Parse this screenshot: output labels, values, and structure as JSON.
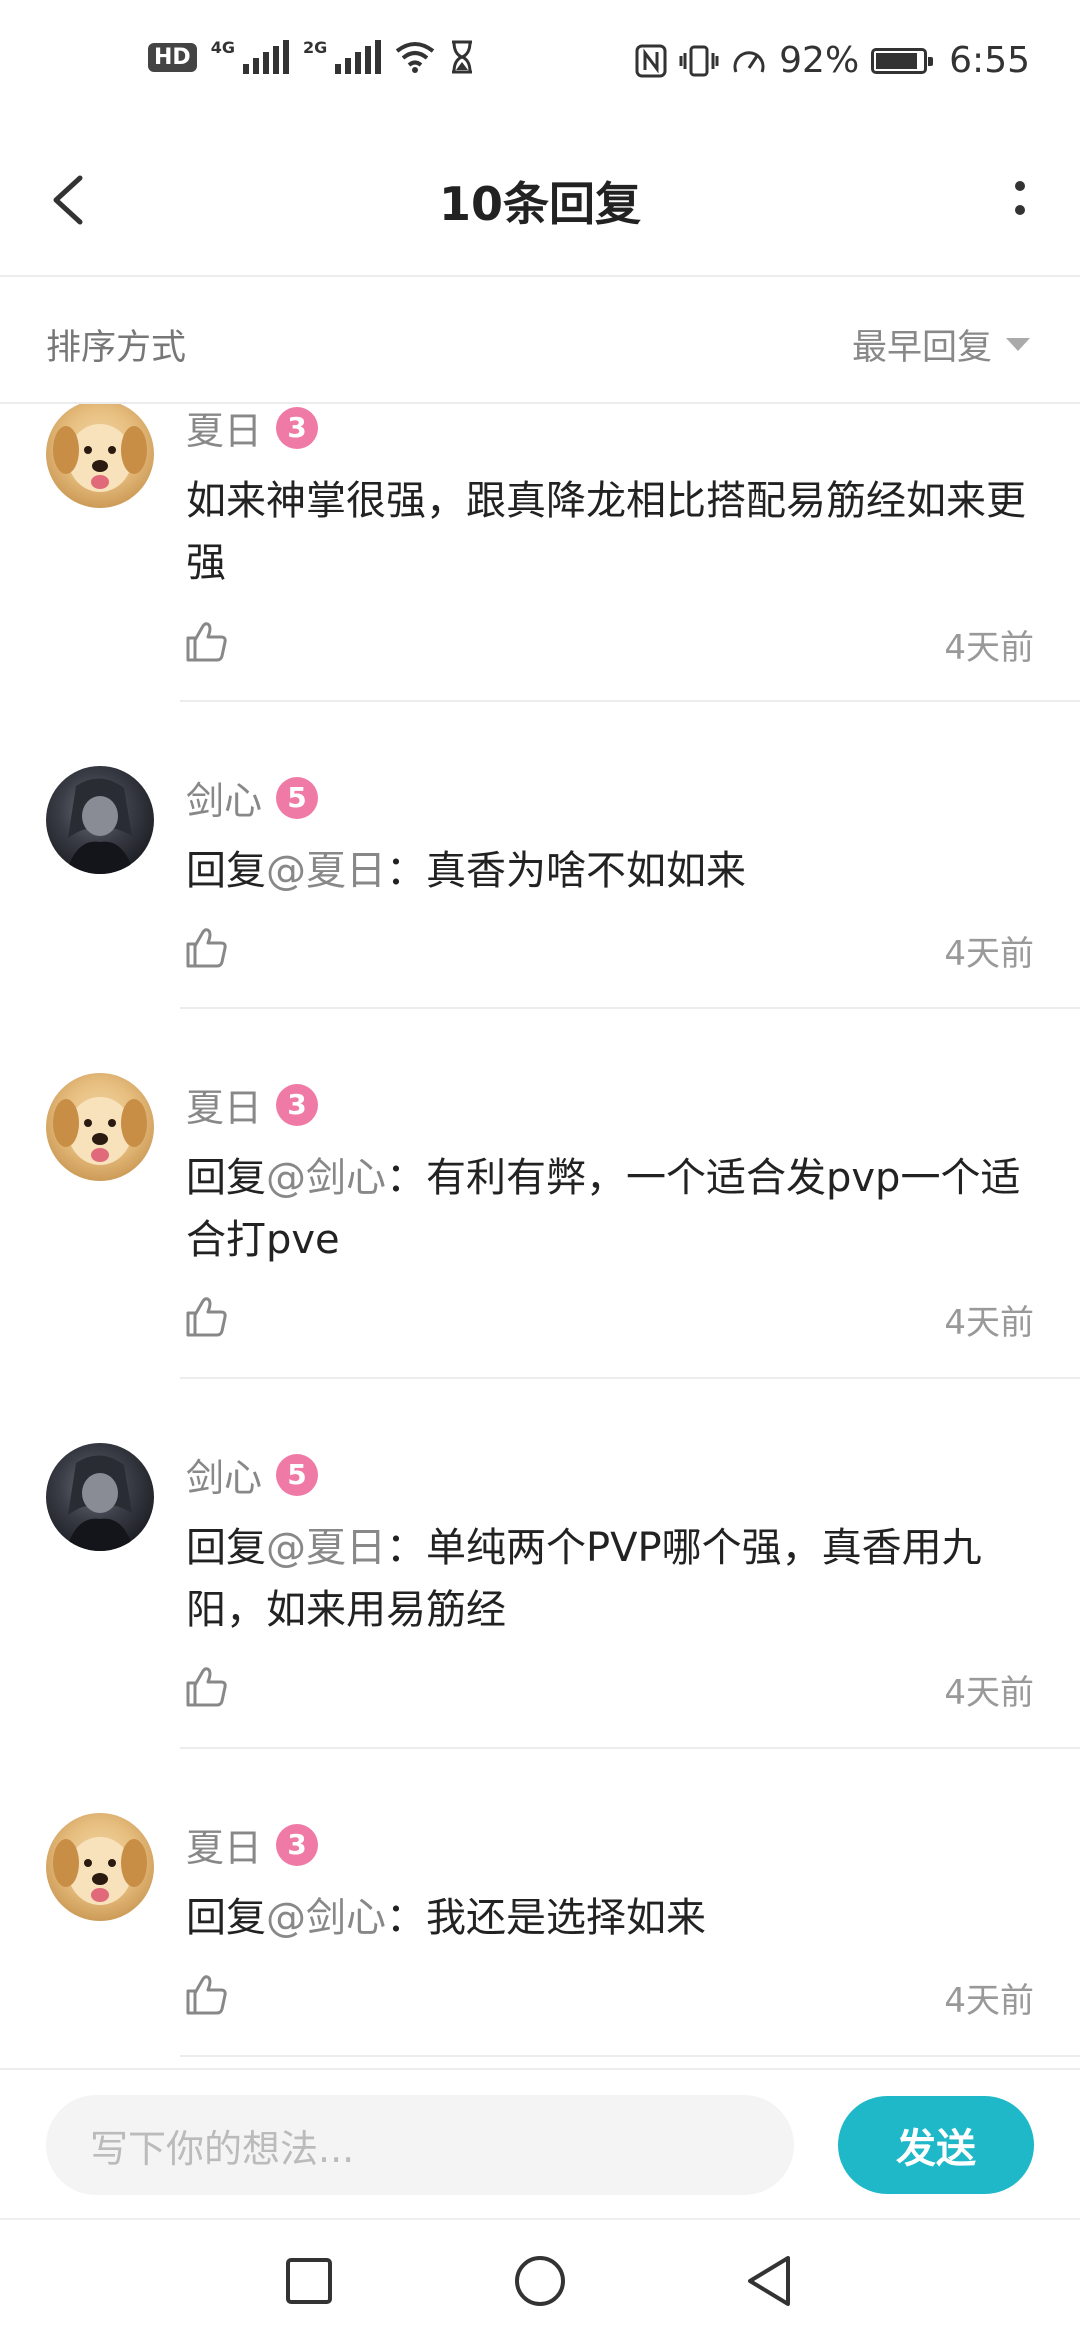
{
  "status_bar": {
    "net1": "4G",
    "net2": "2G",
    "battery_percent": "92%",
    "battery_level": 0.92,
    "time": "6:55"
  },
  "header": {
    "title": "10条回复"
  },
  "sort": {
    "label": "排序方式",
    "value": "最早回复"
  },
  "replies": [
    {
      "user": "夏日",
      "level": "3",
      "avatar": "dog",
      "text": "如来神掌很强，跟真降龙相比搭配易筋经如来更强",
      "reply_to": "",
      "time": "4天前"
    },
    {
      "user": "剑心",
      "level": "5",
      "avatar": "dark",
      "text": "：真香为啥不如如来",
      "reply_prefix": "回复",
      "reply_to": "@夏日",
      "time": "4天前"
    },
    {
      "user": "夏日",
      "level": "3",
      "avatar": "dog",
      "text": "：有利有弊，一个适合发pvp一个适合打pve",
      "reply_prefix": "回复",
      "reply_to": "@剑心",
      "time": "4天前"
    },
    {
      "user": "剑心",
      "level": "5",
      "avatar": "dark",
      "text": "：单纯两个PVP哪个强，真香用九阳，如来用易筋经",
      "reply_prefix": "回复",
      "reply_to": "@夏日",
      "time": "4天前"
    },
    {
      "user": "夏日",
      "level": "3",
      "avatar": "dog",
      "text": "：我还是选择如来",
      "reply_prefix": "回复",
      "reply_to": "@剑心",
      "time": "4天前"
    }
  ],
  "input": {
    "placeholder": "写下你的想法...",
    "send_label": "发送"
  },
  "colors": {
    "accent": "#1fb8c8",
    "level_badge": "#f07aa6"
  }
}
